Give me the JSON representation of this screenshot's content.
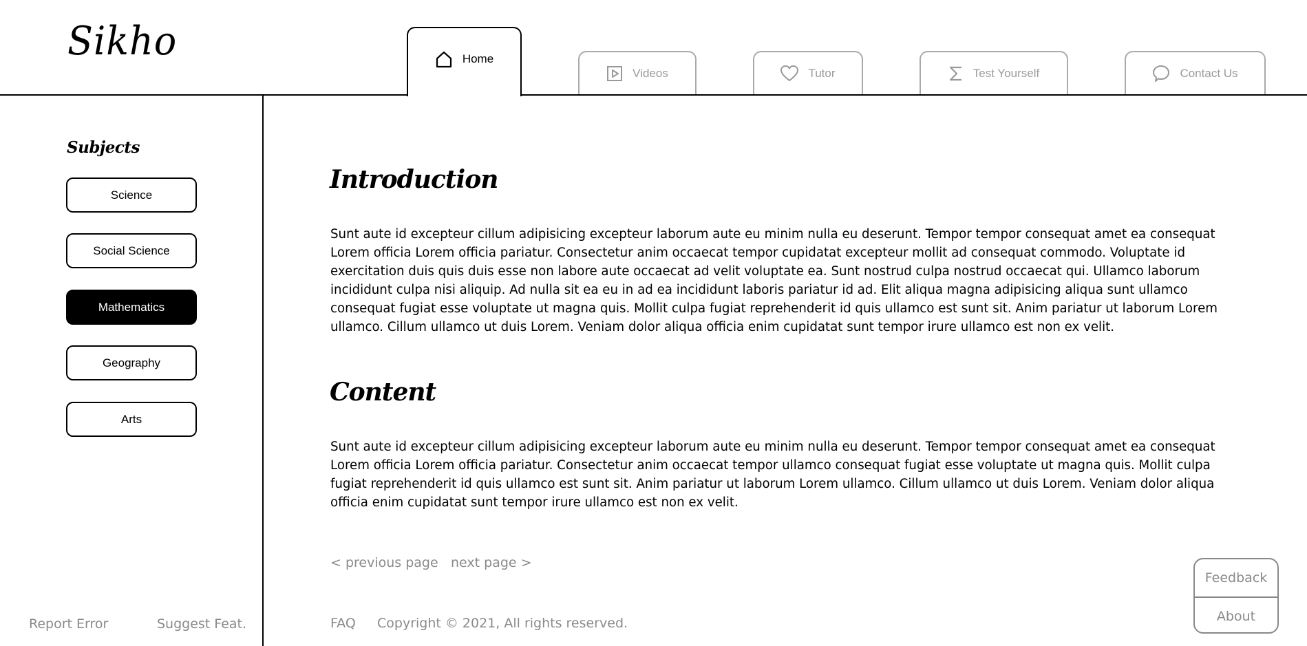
{
  "app": {
    "logo": "Sikho"
  },
  "nav": {
    "tabs": [
      {
        "label": "Home",
        "icon": "home-icon",
        "active": true
      },
      {
        "label": "Videos",
        "icon": "play-icon",
        "active": false
      },
      {
        "label": "Tutor",
        "icon": "heart-icon",
        "active": false
      },
      {
        "label": "Test Yourself",
        "icon": "sigma-icon",
        "active": false
      },
      {
        "label": "Contact Us",
        "icon": "speech-bubble-icon",
        "active": false
      }
    ]
  },
  "sidebar": {
    "title": "Subjects",
    "subjects": [
      {
        "label": "Science",
        "active": false
      },
      {
        "label": "Social Science",
        "active": false
      },
      {
        "label": "Mathematics",
        "active": true
      },
      {
        "label": "Geography",
        "active": false
      },
      {
        "label": "Arts",
        "active": false
      }
    ],
    "footer": {
      "report": "Report Error",
      "suggest": "Suggest Feat."
    }
  },
  "main": {
    "sections": [
      {
        "heading": "Introduction",
        "text": "Sunt aute id excepteur cillum adipisicing excepteur laborum aute eu minim nulla eu deserunt. Tempor tempor consequat amet ea consequat Lorem officia Lorem officia pariatur. Consectetur anim occaecat tempor cupidatat excepteur mollit ad consequat commodo. Voluptate id exercitation duis quis duis esse non labore aute occaecat ad velit voluptate ea. Sunt nostrud culpa nostrud occaecat qui. Ullamco laborum incididunt culpa nisi aliquip. Ad nulla sit ea eu in ad ea incididunt laboris pariatur id ad. Elit aliqua magna adipisicing aliqua sunt ullamco consequat fugiat esse voluptate ut magna quis. Mollit culpa fugiat reprehenderit id quis ullamco est sunt sit. Anim pariatur ut laborum Lorem ullamco. Cillum ullamco ut duis Lorem. Veniam dolor aliqua officia enim cupidatat sunt tempor irure ullamco est non ex velit."
      },
      {
        "heading": "Content",
        "text": "Sunt aute id excepteur cillum adipisicing excepteur laborum aute eu minim nulla eu deserunt. Tempor tempor consequat amet ea consequat Lorem officia Lorem officia pariatur. Consectetur anim occaecat tempor ullamco consequat fugiat esse voluptate ut magna quis. Mollit culpa fugiat reprehenderit id quis ullamco est sunt sit. Anim pariatur ut laborum Lorem ullamco. Cillum ullamco ut duis Lorem. Veniam dolor aliqua officia enim cupidatat sunt tempor irure ullamco est non ex velit."
      }
    ],
    "pager": {
      "previous": "< previous page",
      "next": "next page >"
    },
    "footer": {
      "faq": "FAQ",
      "copyright": "Copyright © 2021, All rights reserved."
    }
  },
  "floating": {
    "feedback": "Feedback",
    "about": "About"
  },
  "colors": {
    "primary": "#000000",
    "muted_text": "#8a8a8a",
    "inactive_border": "#aaaaaa",
    "background": "#ffffff"
  }
}
